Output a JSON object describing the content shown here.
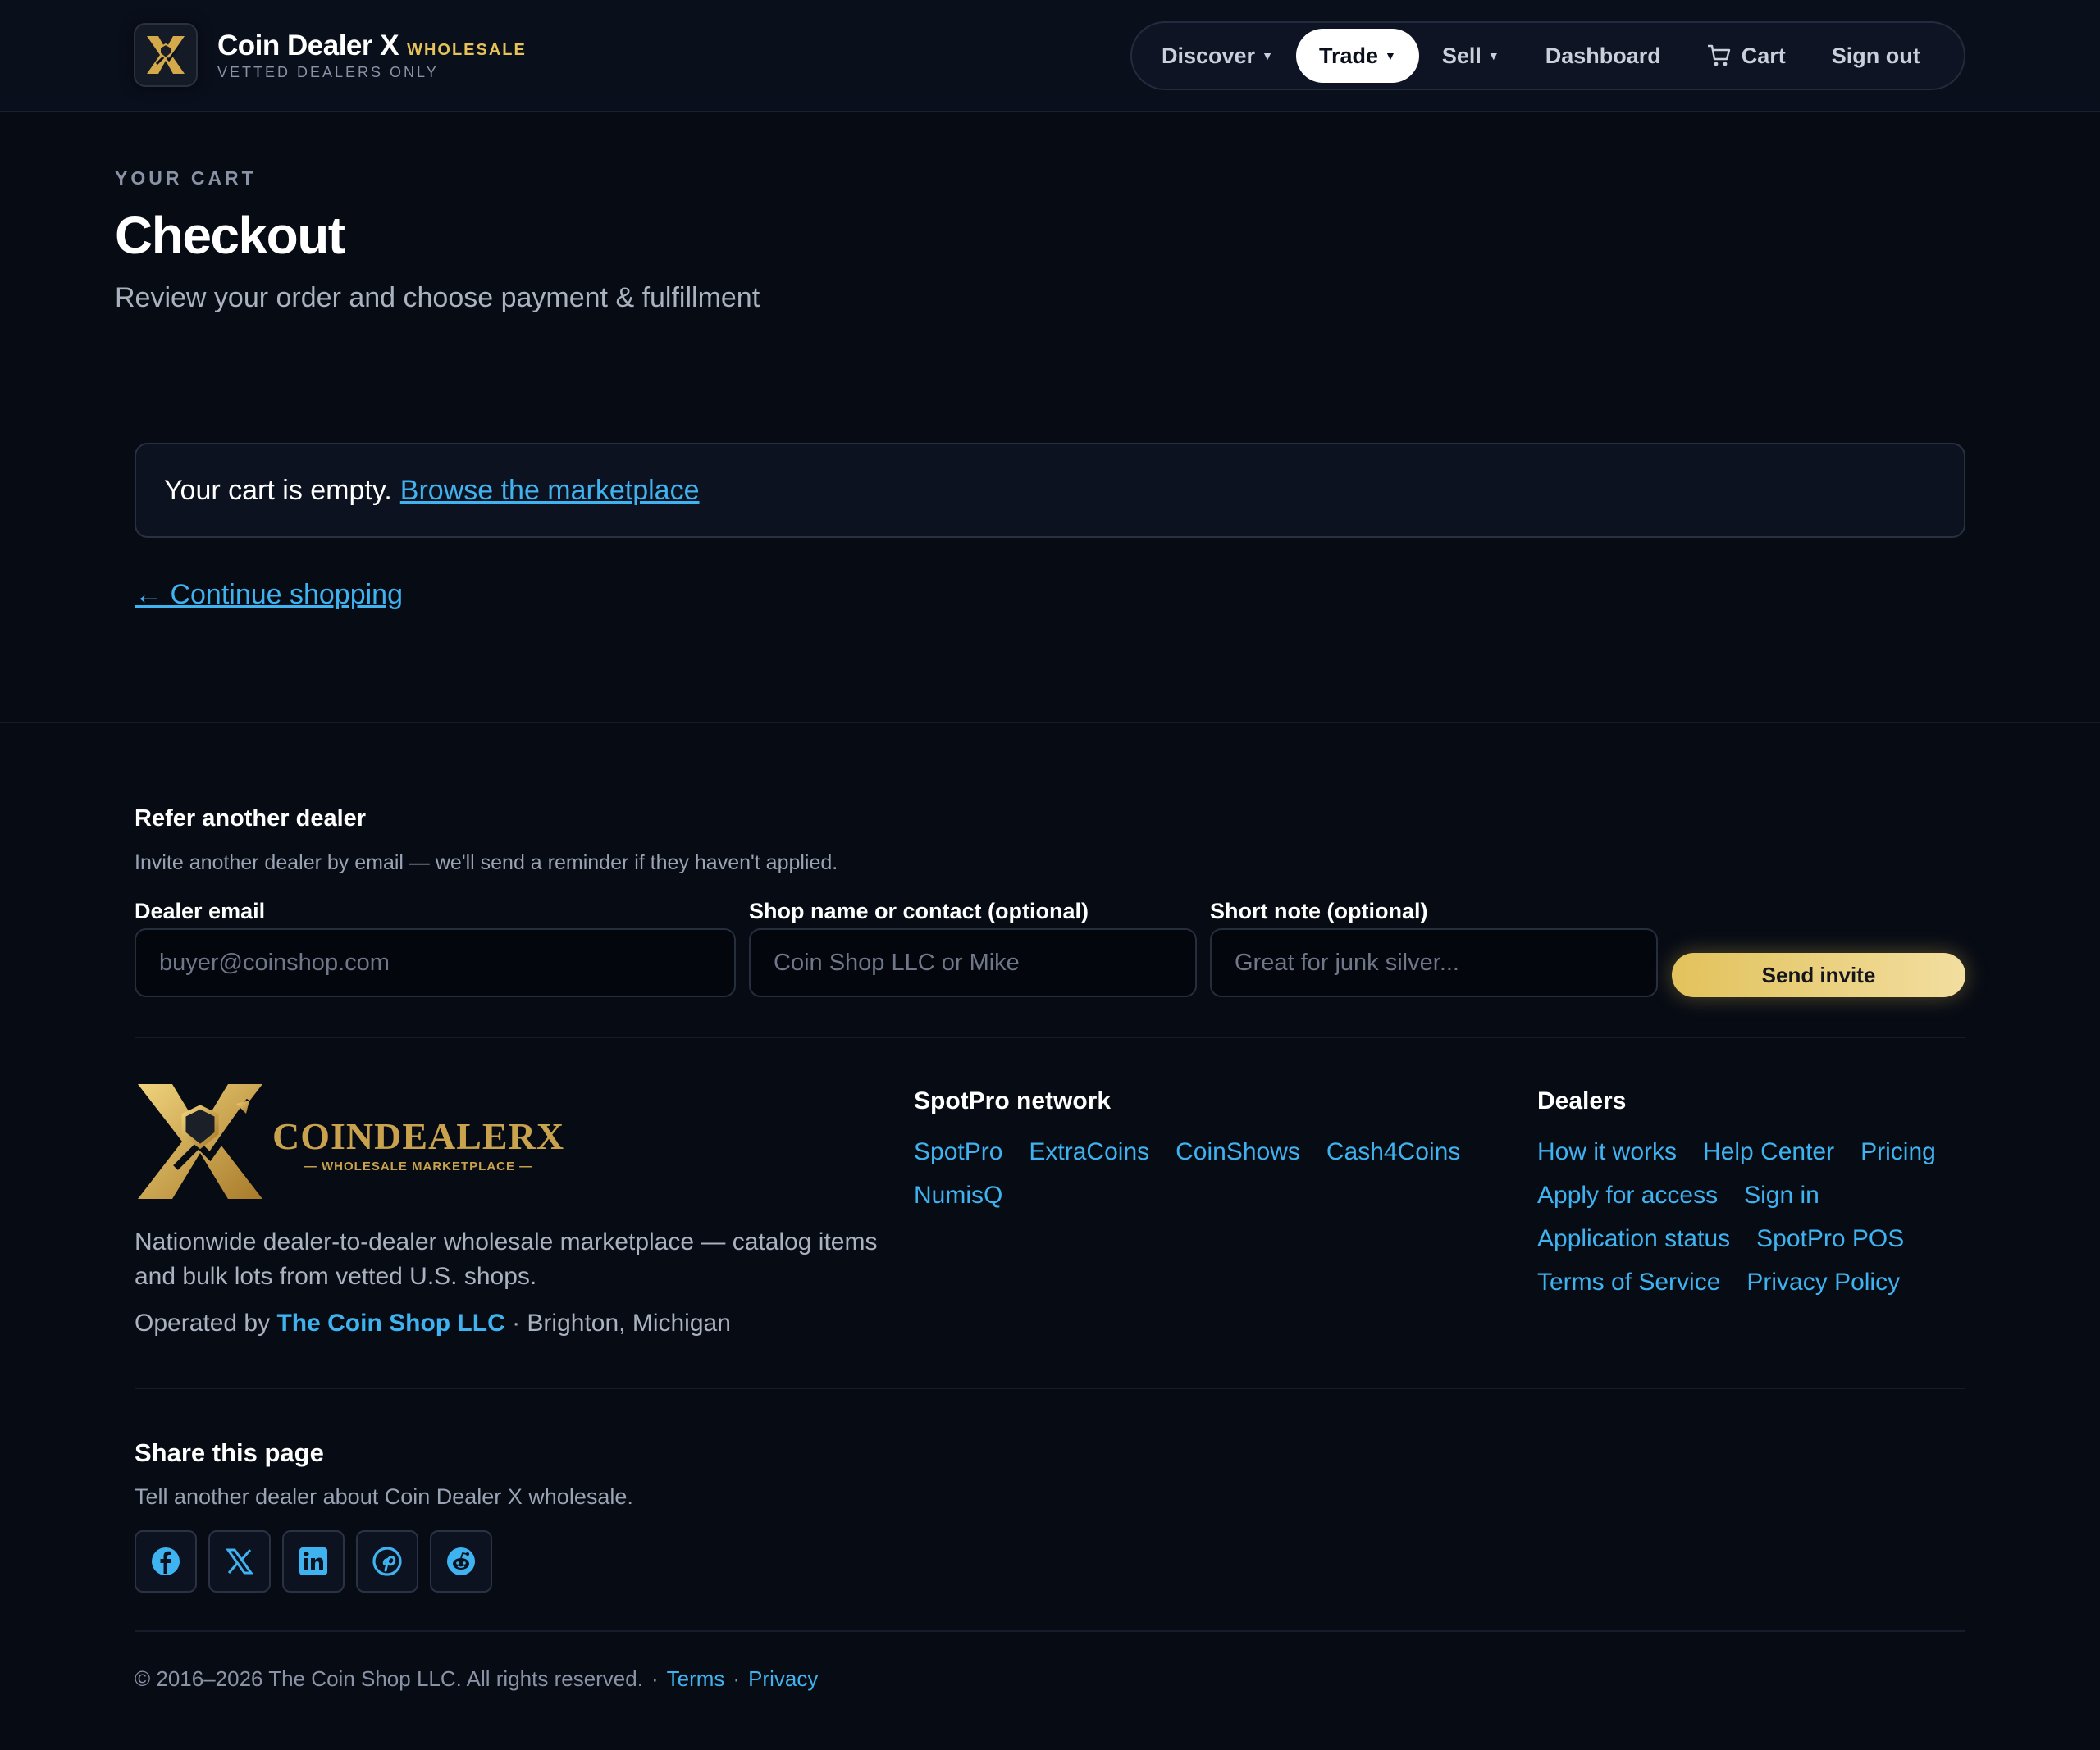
{
  "header": {
    "brand_name": "Coin Dealer X",
    "brand_tag": "WHOLESALE",
    "brand_sub": "VETTED DEALERS ONLY",
    "nav": {
      "discover": "Discover",
      "trade": "Trade",
      "sell": "Sell",
      "dashboard": "Dashboard",
      "cart": "Cart",
      "signout": "Sign out"
    }
  },
  "hero": {
    "eyebrow": "YOUR CART",
    "title": "Checkout",
    "subtitle": "Review your order and choose payment & fulfillment"
  },
  "cart": {
    "empty_text": "Your cart is empty.",
    "browse_link": "Browse the marketplace",
    "continue_link": "← Continue shopping"
  },
  "refer": {
    "title": "Refer another dealer",
    "desc": "Invite another dealer by email — we'll send a reminder if they haven't applied.",
    "email_label": "Dealer email",
    "email_placeholder": "buyer@coinshop.com",
    "shop_label": "Shop name or contact (optional)",
    "shop_placeholder": "Coin Shop LLC or Mike",
    "note_label": "Short note (optional)",
    "note_placeholder": "Great for junk silver...",
    "send_button": "Send invite"
  },
  "footer": {
    "brand_name": "COINDEALERX",
    "brand_sub": "— WHOLESALE MARKETPLACE —",
    "desc": "Nationwide dealer-to-dealer wholesale marketplace — catalog items and bulk lots from vetted U.S. shops.",
    "operated_by": "Operated by",
    "operator": "The Coin Shop LLC",
    "location": "· Brighton, Michigan",
    "network_title": "SpotPro network",
    "network_links": [
      "SpotPro",
      "ExtraCoins",
      "CoinShows",
      "Cash4Coins",
      "NumisQ"
    ],
    "dealers_title": "Dealers",
    "dealers_links": [
      "How it works",
      "Help Center",
      "Pricing",
      "Apply for access",
      "Sign in",
      "Application status",
      "SpotPro POS",
      "Terms of Service",
      "Privacy Policy"
    ]
  },
  "share": {
    "title": "Share this page",
    "desc": "Tell another dealer about Coin Dealer X wholesale.",
    "icons": [
      "facebook-icon",
      "x-icon",
      "linkedin-icon",
      "pinterest-icon",
      "reddit-icon"
    ]
  },
  "bottom": {
    "copyright": "© 2016–2026 The Coin Shop LLC. All rights reserved.",
    "terms": "Terms",
    "privacy": "Privacy"
  },
  "colors": {
    "background": "#070b14",
    "accent_gold": "#e6c35a",
    "link_blue": "#3fb3f0"
  }
}
